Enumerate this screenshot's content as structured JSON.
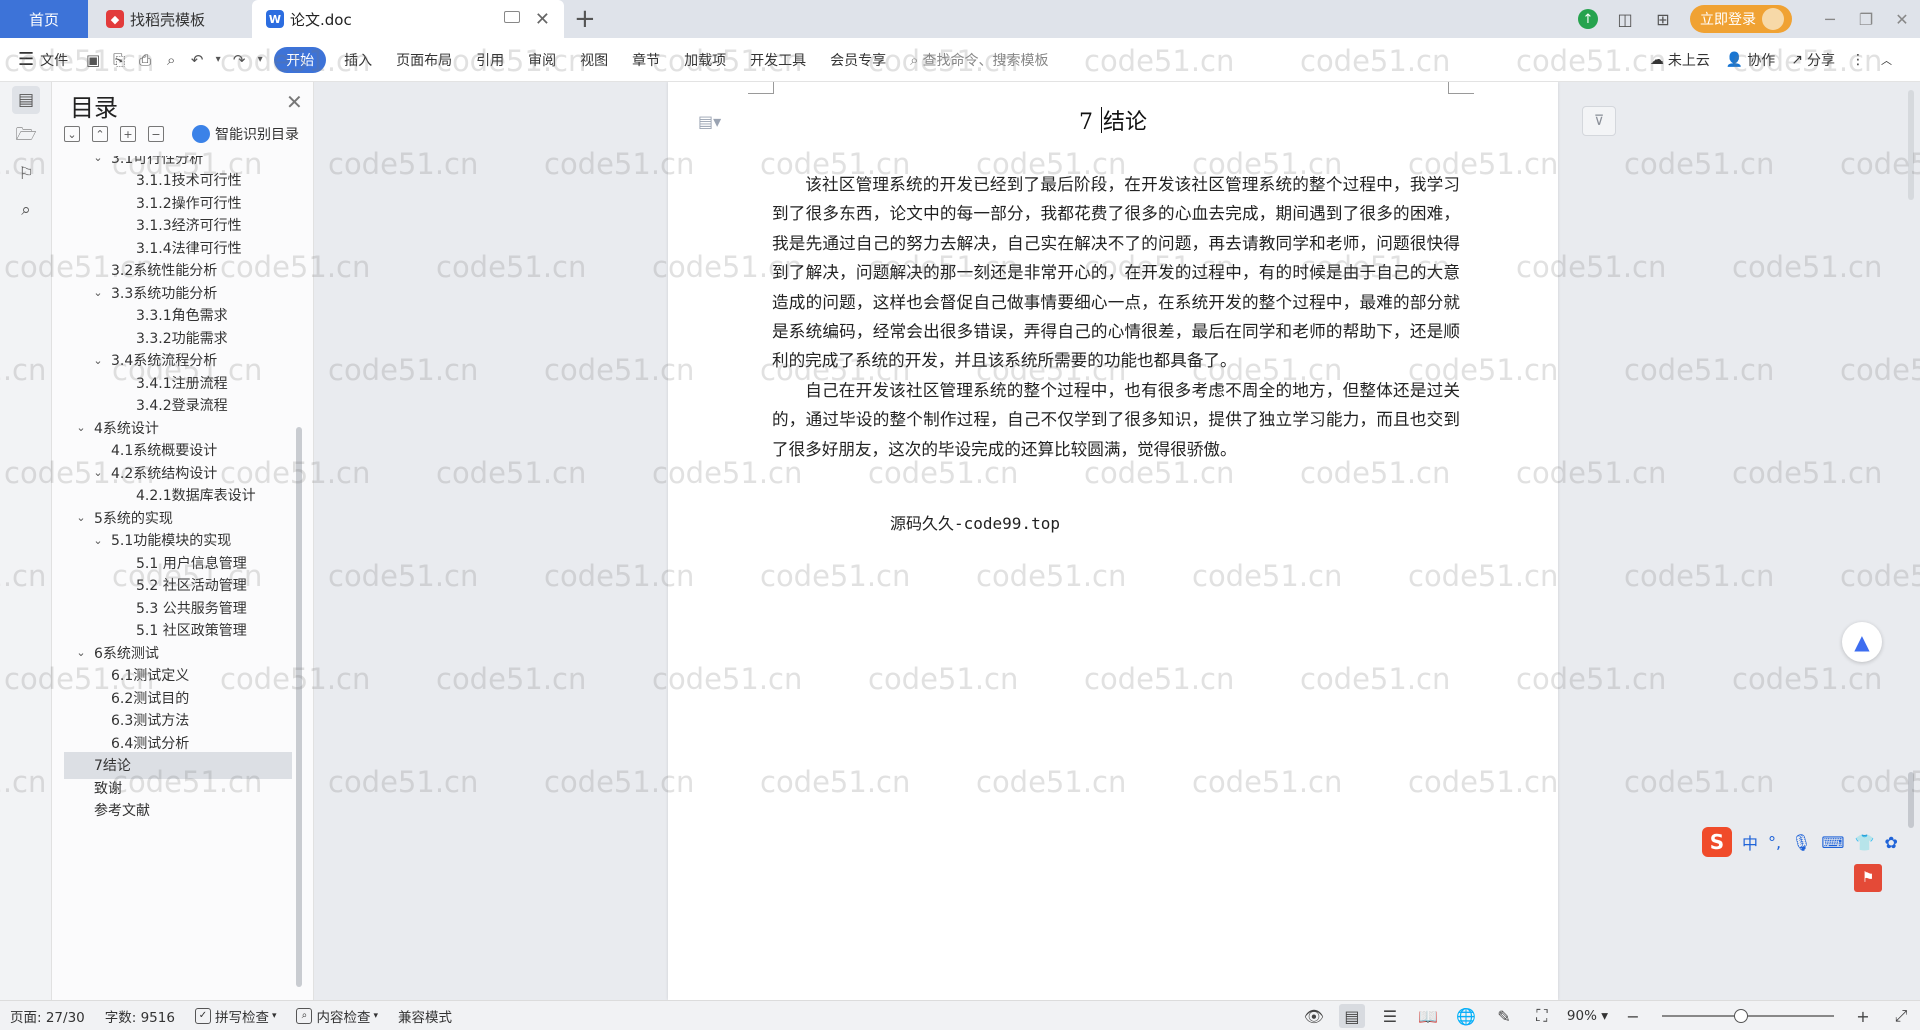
{
  "tabs": {
    "home": "首页",
    "daoke": "找稻壳模板",
    "doc": "论文.doc",
    "add": "+"
  },
  "top_right": {
    "login": "立即登录"
  },
  "ribbon": {
    "file": "文件",
    "menus": [
      "开始",
      "插入",
      "页面布局",
      "引用",
      "审阅",
      "视图",
      "章节",
      "加载项",
      "开发工具",
      "会员专享"
    ],
    "search_placeholder": "查找命令、搜索模板",
    "cloud": "未上云",
    "collab": "协作",
    "share": "分享"
  },
  "toc": {
    "title": "目录",
    "smart": "智能识别目录",
    "items": [
      {
        "label": "3.1可行性分析",
        "level": 2,
        "expanded": true
      },
      {
        "label": "3.1.1技术可行性",
        "level": 3
      },
      {
        "label": "3.1.2操作可行性",
        "level": 3
      },
      {
        "label": "3.1.3经济可行性",
        "level": 3
      },
      {
        "label": "3.1.4法律可行性",
        "level": 3
      },
      {
        "label": "3.2系统性能分析",
        "level": 2
      },
      {
        "label": "3.3系统功能分析",
        "level": 2,
        "expanded": true
      },
      {
        "label": "3.3.1角色需求",
        "level": 3
      },
      {
        "label": "3.3.2功能需求",
        "level": 3
      },
      {
        "label": "3.4系统流程分析",
        "level": 2,
        "expanded": true
      },
      {
        "label": "3.4.1注册流程",
        "level": 3
      },
      {
        "label": "3.4.2登录流程",
        "level": 3
      },
      {
        "label": "4系统设计",
        "level": 1,
        "expanded": true
      },
      {
        "label": "4.1系统概要设计",
        "level": 2
      },
      {
        "label": "4.2系统结构设计",
        "level": 2,
        "expanded": true
      },
      {
        "label": "4.2.1数据库表设计",
        "level": 3
      },
      {
        "label": "5系统的实现",
        "level": 1,
        "expanded": true
      },
      {
        "label": "5.1功能模块的实现",
        "level": 2,
        "expanded": true
      },
      {
        "label": "5.1 用户信息管理",
        "level": 3
      },
      {
        "label": "5.2 社区活动管理",
        "level": 3
      },
      {
        "label": "5.3 公共服务管理",
        "level": 3
      },
      {
        "label": "5.1 社区政策管理",
        "level": 3
      },
      {
        "label": "6系统测试",
        "level": 1,
        "expanded": true
      },
      {
        "label": "6.1测试定义",
        "level": 2
      },
      {
        "label": "6.2测试目的",
        "level": 2
      },
      {
        "label": "6.3测试方法",
        "level": 2
      },
      {
        "label": "6.4测试分析",
        "level": 2
      },
      {
        "label": "7结论",
        "level": 1,
        "selected": true
      },
      {
        "label": "致谢",
        "level": 1
      },
      {
        "label": "参考文献",
        "level": 1
      }
    ]
  },
  "document": {
    "heading_num": "7",
    "heading_text": "结论",
    "paragraphs": [
      "该社区管理系统的开发已经到了最后阶段，在开发该社区管理系统的整个过程中，我学习到了很多东西，论文中的每一部分，我都花费了很多的心血去完成，期间遇到了很多的困难，我是先通过自己的努力去解决，自己实在解决不了的问题，再去请教同学和老师，问题很快得到了解决，问题解决的那一刻还是非常开心的，在开发的过程中，有的时候是由于自己的大意造成的问题，这样也会督促自己做事情要细心一点，在系统开发的整个过程中，最难的部分就是系统编码，经常会出很多错误，弄得自己的心情很差，最后在同学和老师的帮助下，还是顺利的完成了系统的开发，并且该系统所需要的功能也都具备了。",
      "自己在开发该社区管理系统的整个过程中，也有很多考虑不周全的地方，但整体还是过关的，通过毕设的整个制作过程，自己不仅学到了很多知识，提供了独立学习能力，而且也交到了很多好朋友，这次的毕设完成的还算比较圆满，觉得很骄傲。"
    ],
    "source_line": "源码久久-code99.top"
  },
  "ime": {
    "lang": "中"
  },
  "status": {
    "page": "页面: 27/30",
    "words": "字数: 9516",
    "spell": "拼写检查",
    "content_check": "内容检查",
    "compat": "兼容模式",
    "zoom": "90%",
    "zoom_fraction": 0.46
  },
  "watermark_text": "code51.cn"
}
